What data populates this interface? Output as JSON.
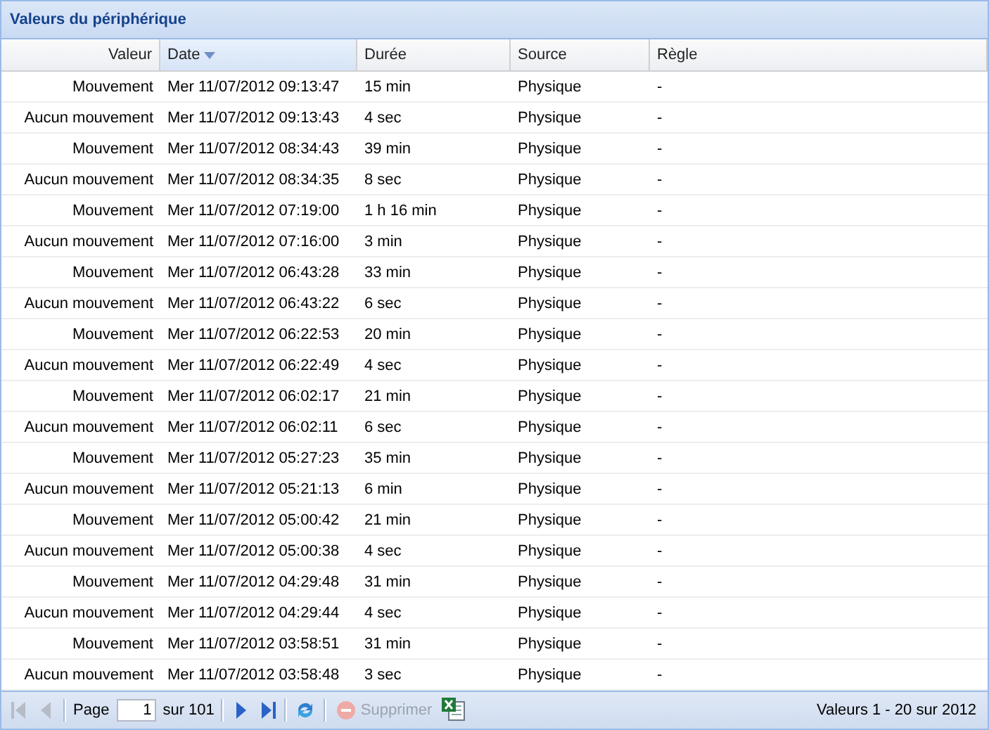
{
  "panel": {
    "title": "Valeurs du périphérique"
  },
  "table": {
    "columns": [
      {
        "label": "Valeur",
        "sorted": false,
        "kind": "value"
      },
      {
        "label": "Date",
        "sorted": true,
        "kind": "text"
      },
      {
        "label": "Durée",
        "sorted": false,
        "kind": "text"
      },
      {
        "label": "Source",
        "sorted": false,
        "kind": "text"
      },
      {
        "label": "Règle",
        "sorted": false,
        "kind": "text"
      }
    ],
    "rows": [
      [
        "Mouvement",
        "Mer 11/07/2012 09:13:47",
        "15 min",
        "Physique",
        "-"
      ],
      [
        "Aucun mouvement",
        "Mer 11/07/2012 09:13:43",
        "4 sec",
        "Physique",
        "-"
      ],
      [
        "Mouvement",
        "Mer 11/07/2012 08:34:43",
        "39 min",
        "Physique",
        "-"
      ],
      [
        "Aucun mouvement",
        "Mer 11/07/2012 08:34:35",
        "8 sec",
        "Physique",
        "-"
      ],
      [
        "Mouvement",
        "Mer 11/07/2012 07:19:00",
        "1 h 16 min",
        "Physique",
        "-"
      ],
      [
        "Aucun mouvement",
        "Mer 11/07/2012 07:16:00",
        "3 min",
        "Physique",
        "-"
      ],
      [
        "Mouvement",
        "Mer 11/07/2012 06:43:28",
        "33 min",
        "Physique",
        "-"
      ],
      [
        "Aucun mouvement",
        "Mer 11/07/2012 06:43:22",
        "6 sec",
        "Physique",
        "-"
      ],
      [
        "Mouvement",
        "Mer 11/07/2012 06:22:53",
        "20 min",
        "Physique",
        "-"
      ],
      [
        "Aucun mouvement",
        "Mer 11/07/2012 06:22:49",
        "4 sec",
        "Physique",
        "-"
      ],
      [
        "Mouvement",
        "Mer 11/07/2012 06:02:17",
        "21 min",
        "Physique",
        "-"
      ],
      [
        "Aucun mouvement",
        "Mer 11/07/2012 06:02:11",
        "6 sec",
        "Physique",
        "-"
      ],
      [
        "Mouvement",
        "Mer 11/07/2012 05:27:23",
        "35 min",
        "Physique",
        "-"
      ],
      [
        "Aucun mouvement",
        "Mer 11/07/2012 05:21:13",
        "6 min",
        "Physique",
        "-"
      ],
      [
        "Mouvement",
        "Mer 11/07/2012 05:00:42",
        "21 min",
        "Physique",
        "-"
      ],
      [
        "Aucun mouvement",
        "Mer 11/07/2012 05:00:38",
        "4 sec",
        "Physique",
        "-"
      ],
      [
        "Mouvement",
        "Mer 11/07/2012 04:29:48",
        "31 min",
        "Physique",
        "-"
      ],
      [
        "Aucun mouvement",
        "Mer 11/07/2012 04:29:44",
        "4 sec",
        "Physique",
        "-"
      ],
      [
        "Mouvement",
        "Mer 11/07/2012 03:58:51",
        "31 min",
        "Physique",
        "-"
      ],
      [
        "Aucun mouvement",
        "Mer 11/07/2012 03:58:48",
        "3 sec",
        "Physique",
        "-"
      ]
    ]
  },
  "pager": {
    "first_disabled": true,
    "prev_disabled": true,
    "page_label": "Page",
    "page": "1",
    "of_label": "sur 101",
    "next_disabled": false,
    "last_disabled": false,
    "delete": {
      "label": "Supprimer",
      "disabled": true
    },
    "summary": "Valeurs 1 - 20 sur 2012"
  }
}
